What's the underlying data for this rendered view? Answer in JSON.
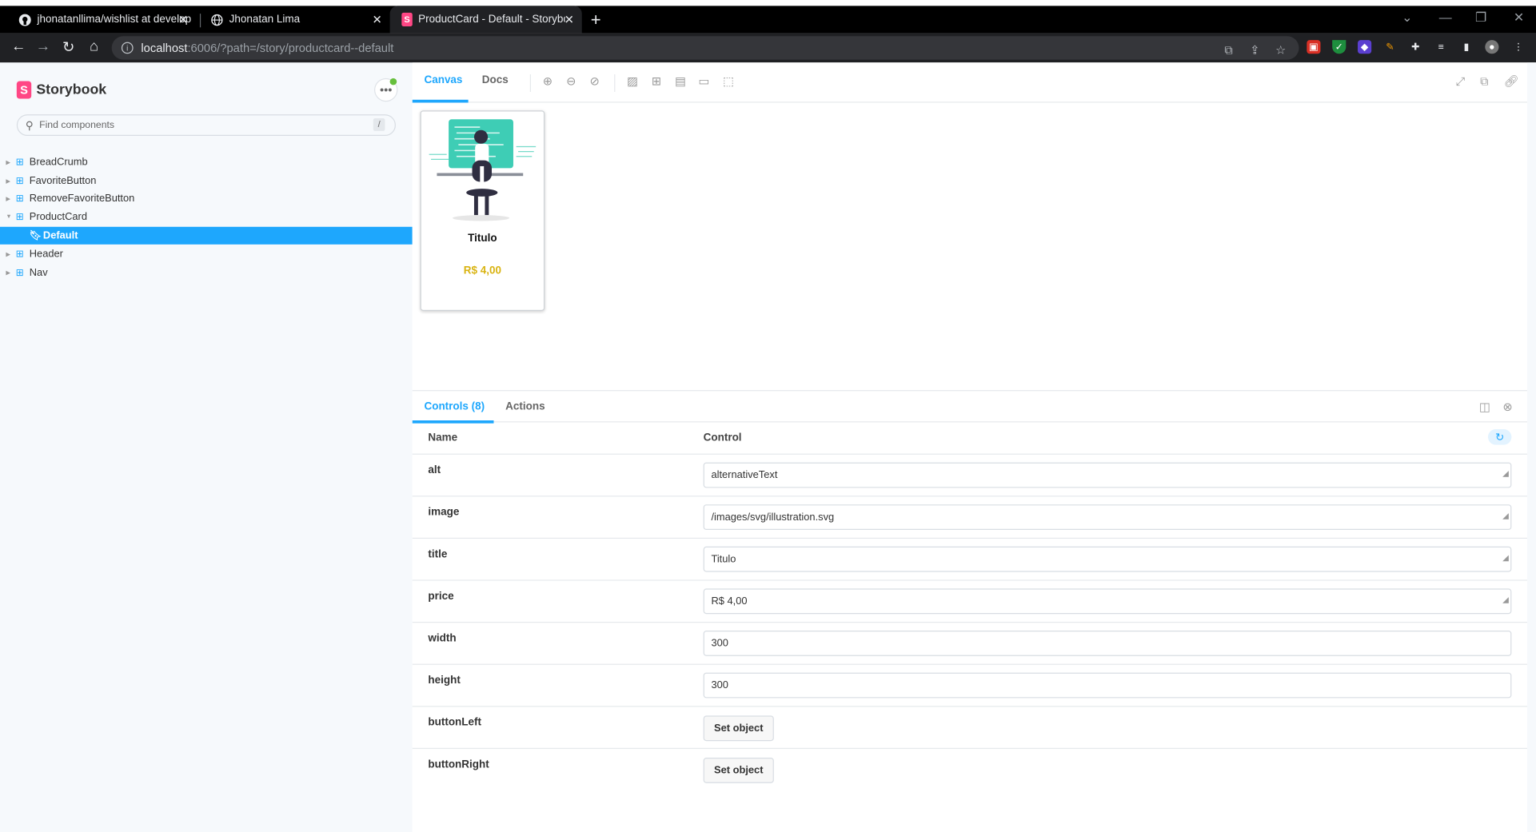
{
  "browser": {
    "tabs": [
      {
        "title": "jhonatanllima/wishlist at develop",
        "icon": "github-icon"
      },
      {
        "title": "Jhonatan Lima",
        "icon": "globe-icon"
      },
      {
        "title": "ProductCard - Default - Storybook",
        "icon": "storybook-icon"
      }
    ],
    "url_host": "localhost",
    "url_rest": ":6006/?path=/story/productcard--default"
  },
  "sidebar": {
    "brand": "Storybook",
    "search_placeholder": "Find components",
    "search_shortcut": "/",
    "items": [
      {
        "label": "BreadCrumb"
      },
      {
        "label": "FavoriteButton"
      },
      {
        "label": "RemoveFavoriteButton"
      },
      {
        "label": "ProductCard"
      },
      {
        "label": "Default"
      },
      {
        "label": "Header"
      },
      {
        "label": "Nav"
      }
    ]
  },
  "toolbar": {
    "canvas_tab": "Canvas",
    "docs_tab": "Docs"
  },
  "card": {
    "title": "Titulo",
    "price": "R$ 4,00"
  },
  "addons": {
    "controls_tab": "Controls (8)",
    "actions_tab": "Actions",
    "name_header": "Name",
    "control_header": "Control",
    "rows": [
      {
        "name": "alt",
        "value": "alternativeText"
      },
      {
        "name": "image",
        "value": "/images/svg/illustration.svg"
      },
      {
        "name": "title",
        "value": "Titulo"
      },
      {
        "name": "price",
        "value": "R$ 4,00"
      },
      {
        "name": "width",
        "value": "300"
      },
      {
        "name": "height",
        "value": "300"
      },
      {
        "name": "buttonLeft",
        "value": "Set object"
      },
      {
        "name": "buttonRight",
        "value": "Set object"
      }
    ]
  },
  "colors": {
    "accent": "#1ea7fd",
    "brand": "#ff4785",
    "price": "#d9b310",
    "illustration": "#3ecdb5"
  }
}
